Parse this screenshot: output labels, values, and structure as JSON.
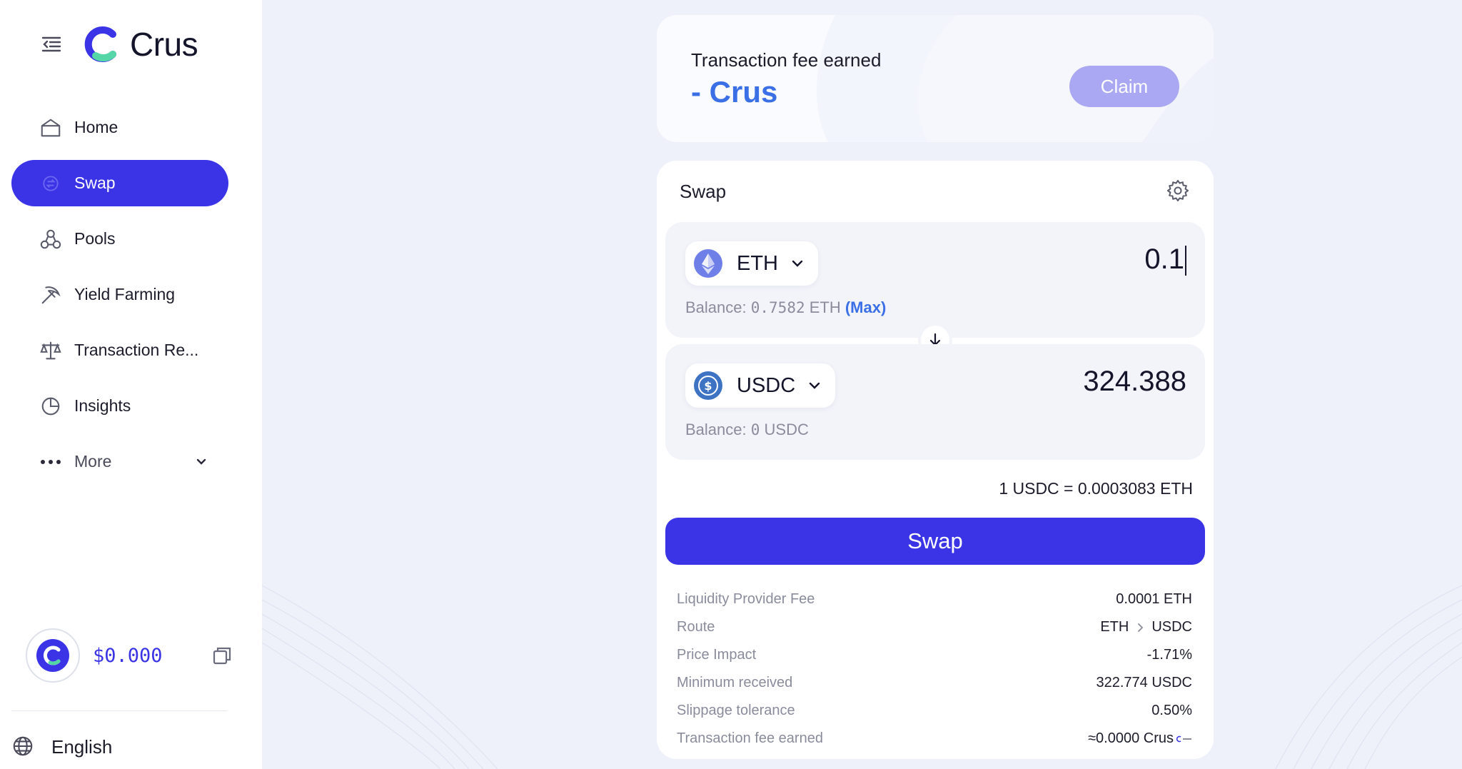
{
  "app": {
    "name": "Crus"
  },
  "sidebar": {
    "items": [
      {
        "label": "Home",
        "icon": "home-icon"
      },
      {
        "label": "Swap",
        "icon": "swap-icon",
        "active": true
      },
      {
        "label": "Pools",
        "icon": "pools-icon"
      },
      {
        "label": "Yield Farming",
        "icon": "pickaxe-icon"
      },
      {
        "label": "Transaction Re...",
        "icon": "scale-icon"
      },
      {
        "label": "Insights",
        "icon": "pie-chart-icon"
      },
      {
        "label": "More",
        "icon": "more-dots-icon"
      }
    ],
    "balance": "$0.000",
    "language": "English"
  },
  "fee_card": {
    "label": "Transaction fee earned",
    "value": "- Crus",
    "claim_label": "Claim"
  },
  "swap": {
    "title": "Swap",
    "from": {
      "token": "ETH",
      "amount": "0.1",
      "balance_prefix": "Balance:",
      "balance_value": "0.7582",
      "balance_unit": "ETH",
      "max_label": "(Max)"
    },
    "to": {
      "token": "USDC",
      "amount": "324.388",
      "balance_prefix": "Balance:",
      "balance_value": "0",
      "balance_unit": "USDC"
    },
    "rate": "1 USDC = 0.0003083 ETH",
    "button_label": "Swap",
    "details": {
      "lp_fee_label": "Liquidity Provider Fee",
      "lp_fee_value": "0.0001 ETH",
      "route_label": "Route",
      "route_from": "ETH",
      "route_to": "USDC",
      "price_impact_label": "Price Impact",
      "price_impact_value": "-1.71%",
      "min_received_label": "Minimum received",
      "min_received_value": "322.774 USDC",
      "slippage_label": "Slippage tolerance",
      "slippage_value": "0.50%",
      "tx_fee_label": "Transaction fee earned",
      "tx_fee_value": "≈0.0000 Crus"
    }
  },
  "colors": {
    "accent": "#3a34e6",
    "link": "#3a6fe6",
    "claim_disabled": "#aaa8f2",
    "background": "#eef1f9"
  }
}
